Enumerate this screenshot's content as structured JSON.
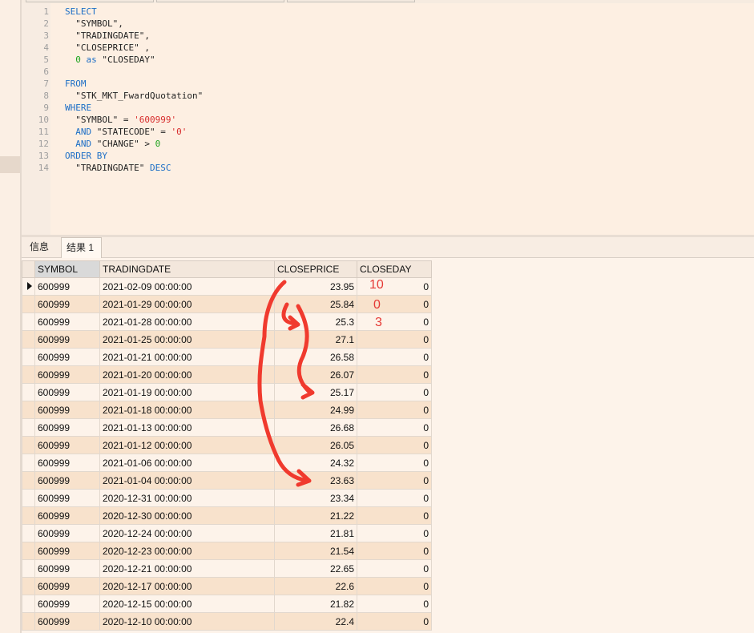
{
  "editor": {
    "lines": [
      {
        "n": "1",
        "segs": [
          {
            "t": "SELECT",
            "c": "kw"
          }
        ]
      },
      {
        "n": "2",
        "segs": [
          {
            "t": "  \"SYMBOL\",",
            "c": ""
          }
        ]
      },
      {
        "n": "3",
        "segs": [
          {
            "t": "  \"TRADINGDATE\",",
            "c": ""
          }
        ]
      },
      {
        "n": "4",
        "segs": [
          {
            "t": "  \"CLOSEPRICE\" ,",
            "c": ""
          }
        ]
      },
      {
        "n": "5",
        "segs": [
          {
            "t": "  ",
            "c": ""
          },
          {
            "t": "0",
            "c": "num"
          },
          {
            "t": " as ",
            "c": "kw"
          },
          {
            "t": "\"CLOSEDAY\"",
            "c": ""
          }
        ]
      },
      {
        "n": "6",
        "segs": [
          {
            "t": "",
            "c": ""
          }
        ]
      },
      {
        "n": "7",
        "segs": [
          {
            "t": "FROM",
            "c": "kw"
          }
        ]
      },
      {
        "n": "8",
        "segs": [
          {
            "t": "  \"STK_MKT_FwardQuotation\"",
            "c": ""
          }
        ]
      },
      {
        "n": "9",
        "segs": [
          {
            "t": "WHERE",
            "c": "kw"
          }
        ]
      },
      {
        "n": "10",
        "segs": [
          {
            "t": "  \"SYMBOL\" = ",
            "c": ""
          },
          {
            "t": "'600999'",
            "c": "str"
          }
        ]
      },
      {
        "n": "11",
        "segs": [
          {
            "t": "  ",
            "c": ""
          },
          {
            "t": "AND",
            "c": "kw"
          },
          {
            "t": " \"STATECODE\" = ",
            "c": ""
          },
          {
            "t": "'0'",
            "c": "str"
          }
        ]
      },
      {
        "n": "12",
        "segs": [
          {
            "t": "  ",
            "c": ""
          },
          {
            "t": "AND",
            "c": "kw"
          },
          {
            "t": " \"CHANGE\" > ",
            "c": ""
          },
          {
            "t": "0",
            "c": "num"
          }
        ]
      },
      {
        "n": "13",
        "segs": [
          {
            "t": "ORDER BY",
            "c": "kw"
          }
        ]
      },
      {
        "n": "14",
        "segs": [
          {
            "t": "  \"TRADINGDATE\" ",
            "c": ""
          },
          {
            "t": "DESC",
            "c": "kw"
          }
        ]
      }
    ]
  },
  "tabs": {
    "info": "信息",
    "result": "结果 1"
  },
  "grid": {
    "columns": [
      "SYMBOL",
      "TRADINGDATE",
      "CLOSEPRICE",
      "CLOSEDAY"
    ],
    "rows": [
      [
        "600999",
        "2021-02-09 00:00:00",
        "23.95",
        "0"
      ],
      [
        "600999",
        "2021-01-29 00:00:00",
        "25.84",
        "0"
      ],
      [
        "600999",
        "2021-01-28 00:00:00",
        "25.3",
        "0"
      ],
      [
        "600999",
        "2021-01-25 00:00:00",
        "27.1",
        "0"
      ],
      [
        "600999",
        "2021-01-21 00:00:00",
        "26.58",
        "0"
      ],
      [
        "600999",
        "2021-01-20 00:00:00",
        "26.07",
        "0"
      ],
      [
        "600999",
        "2021-01-19 00:00:00",
        "25.17",
        "0"
      ],
      [
        "600999",
        "2021-01-18 00:00:00",
        "24.99",
        "0"
      ],
      [
        "600999",
        "2021-01-13 00:00:00",
        "26.68",
        "0"
      ],
      [
        "600999",
        "2021-01-12 00:00:00",
        "26.05",
        "0"
      ],
      [
        "600999",
        "2021-01-06 00:00:00",
        "24.32",
        "0"
      ],
      [
        "600999",
        "2021-01-04 00:00:00",
        "23.63",
        "0"
      ],
      [
        "600999",
        "2020-12-31 00:00:00",
        "23.34",
        "0"
      ],
      [
        "600999",
        "2020-12-30 00:00:00",
        "21.22",
        "0"
      ],
      [
        "600999",
        "2020-12-24 00:00:00",
        "21.81",
        "0"
      ],
      [
        "600999",
        "2020-12-23 00:00:00",
        "21.54",
        "0"
      ],
      [
        "600999",
        "2020-12-21 00:00:00",
        "22.65",
        "0"
      ],
      [
        "600999",
        "2020-12-17 00:00:00",
        "22.6",
        "0"
      ],
      [
        "600999",
        "2020-12-15 00:00:00",
        "21.82",
        "0"
      ],
      [
        "600999",
        "2020-12-10 00:00:00",
        "22.4",
        "0"
      ]
    ]
  },
  "annotations": {
    "a1": "10",
    "a2": "0",
    "a3": "3"
  },
  "colors": {
    "keyword": "#1c6ec6",
    "string": "#d72c2c",
    "number": "#1ea31e",
    "annotation": "#e53935"
  }
}
